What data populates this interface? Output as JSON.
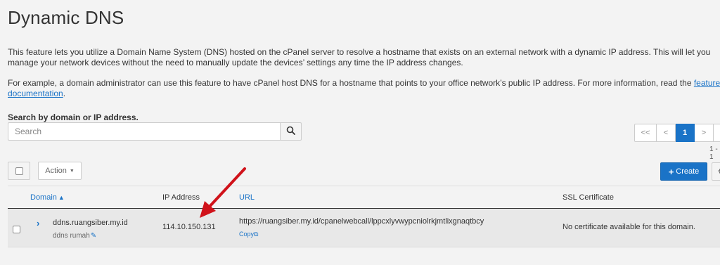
{
  "page": {
    "title": "Dynamic DNS",
    "intro_1": "This feature lets you utilize a Domain Name System (DNS) hosted on the cPanel server to resolve a hostname that exists on an external network with a dynamic IP address. This will let you manage your network devices without the need to manually update the devices’ settings any time the IP address changes.",
    "intro_2_prefix": "For example, a domain administrator can use this feature to have cPanel host DNS for a hostname that points to your office network’s public IP address. For more information, read the ",
    "intro_2_link": "feature documentation",
    "intro_2_suffix": "."
  },
  "search": {
    "label": "Search by domain or IP address.",
    "placeholder": "Search",
    "value": "",
    "button_icon": "search-icon"
  },
  "pagination": {
    "first": "<<",
    "prev": "<",
    "current": "1",
    "next": ">",
    "info": "1 - 1"
  },
  "toolbar": {
    "action_label": "Action",
    "create_label": "Create",
    "settings_icon": "gear-icon"
  },
  "table": {
    "columns": {
      "domain": "Domain",
      "ip": "IP Address",
      "url": "URL",
      "ssl": "SSL Certificate"
    },
    "rows": [
      {
        "domain": "ddns.ruangsiber.my.id",
        "description": "ddns rumah",
        "ip": "114.10.150.131",
        "url": "https://ruangsiber.my.id/cpanelwebcall/lppcxlyvwypcniolrkjmtlixgnaqtbcy",
        "copy_label": "Copy",
        "ssl": "No certificate available for this domain."
      }
    ]
  },
  "colors": {
    "accent": "#1a73c7",
    "annotation_arrow": "#d0121a"
  }
}
